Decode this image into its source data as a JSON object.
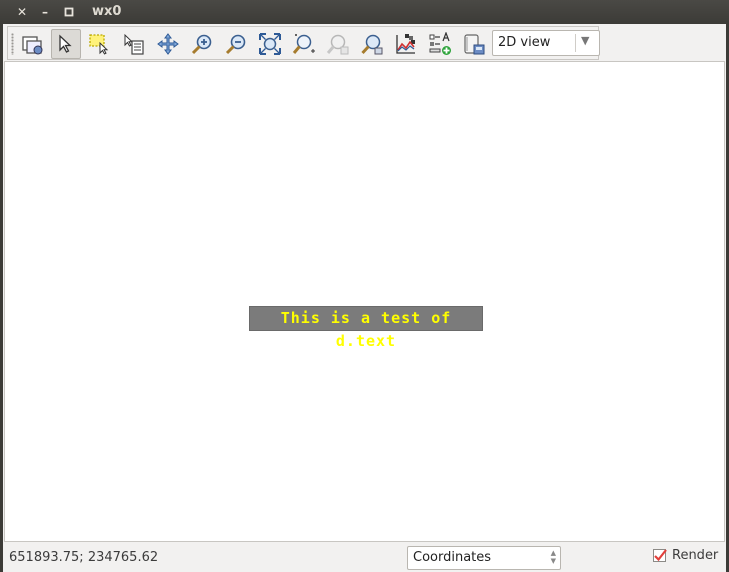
{
  "window": {
    "title": "wx0",
    "close_glyph": "✕",
    "minimize_glyph": "–",
    "maximize_glyph": "▫"
  },
  "toolbar": {
    "buttons": [
      {
        "name": "display-map-icon"
      },
      {
        "name": "pointer-icon",
        "active": true
      },
      {
        "name": "select-features-icon"
      },
      {
        "name": "query-raster-icon"
      },
      {
        "name": "pan-icon"
      },
      {
        "name": "zoom-in-icon"
      },
      {
        "name": "zoom-out-icon"
      },
      {
        "name": "zoom-to-extent-icon"
      },
      {
        "name": "zoom-back-icon"
      },
      {
        "name": "zoom-back-disabled-icon"
      },
      {
        "name": "zoom-options-icon"
      },
      {
        "name": "analyze-map-icon"
      },
      {
        "name": "add-overlay-icon"
      },
      {
        "name": "save-map-icon"
      }
    ],
    "view_mode": "2D view"
  },
  "map": {
    "text_label": "This is a test of d.text",
    "text_color": "#ffff00",
    "text_bg": "#7b7b7b"
  },
  "statusbar": {
    "coordinates": "651893.75; 234765.62",
    "mode": "Coordinates",
    "render_label": "Render",
    "render_checked": true,
    "checkmark_color": "#e2403b"
  }
}
